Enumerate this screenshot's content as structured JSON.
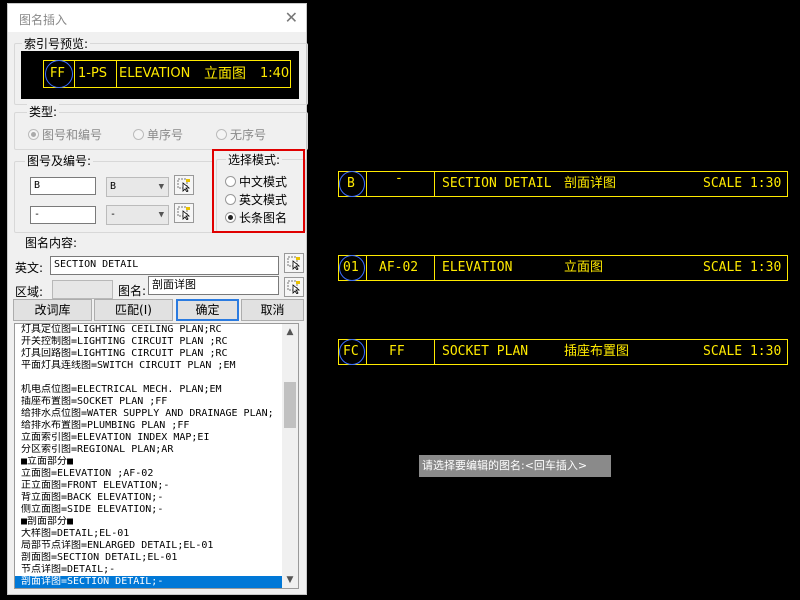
{
  "dialog": {
    "title": "图名插入",
    "close_glyph": "✕",
    "preview": {
      "label": "索引号预览:",
      "circle_text": "FF",
      "sheet": "1-PS",
      "name_en": "ELEVATION",
      "name_cn": "立面图",
      "scale": "1:40"
    },
    "type_group": {
      "label": "类型:",
      "options": [
        "图号和编号",
        "单序号",
        "无序号"
      ]
    },
    "number_group": {
      "label": "图号及编号:",
      "input1": "B",
      "combo1": "B",
      "input2": "-",
      "combo2": "-"
    },
    "mode_group": {
      "label": "选择模式:",
      "options": [
        "中文模式",
        "英文模式",
        "长条图名"
      ]
    },
    "content_label": "图名内容:",
    "english_label": "英文:",
    "english_value": "SECTION DETAIL",
    "area_label": "区域:",
    "area_value": "",
    "name_label": "图名:",
    "name_value": "剖面详图",
    "buttons": {
      "edit_lib": "改词库",
      "match": "匹配(I)",
      "ok": "确定",
      "cancel": "取消"
    },
    "list_items": [
      "灯具定位图=LIGHTING CEILING PLAN;RC",
      "开关控制图=LIGHTING CIRCUIT PLAN  ;RC",
      "灯具回路图=LIGHTING CIRCUIT PLAN  ;RC",
      "平面灯具连线图=SWITCH CIRCUIT PLAN  ;EM",
      "",
      "机电点位图=ELECTRICAL MECH. PLAN;EM",
      "插座布置图=SOCKET PLAN  ;FF",
      "给排水点位图=WATER SUPPLY AND DRAINAGE PLAN;",
      "给排水布置图=PLUMBING PLAN  ;FF",
      "立面索引图=ELEVATION INDEX MAP;EI",
      "分区索引图=REGIONAL PLAN;AR",
      "■立面部分■",
      "立面图=ELEVATION ;AF-02",
      "正立面图=FRONT ELEVATION;-",
      "背立面图=BACK ELEVATION;-",
      "侧立面图=SIDE ELEVATION;-",
      "■剖面部分■",
      "大样图=DETAIL;EL-01",
      "局部节点详图=ENLARGED DETAIL;EL-01",
      "剖面图=SECTION DETAIL;EL-01",
      "节点详图=DETAIL;-",
      "剖面详图=SECTION DETAIL;-"
    ],
    "selected_index": 21
  },
  "canvas": {
    "rows": [
      {
        "circle": "B",
        "number": "-",
        "name_en": "SECTION DETAIL",
        "name_cn": "剖面详图",
        "scale": "SCALE 1:30"
      },
      {
        "circle": "01",
        "number": "AF-02",
        "name_en": "ELEVATION",
        "name_cn": "立面图",
        "scale": "SCALE 1:30"
      },
      {
        "circle": "FC",
        "number": "FF",
        "name_en": "SOCKET PLAN",
        "name_cn": "插座布置图",
        "scale": "SCALE 1:30"
      }
    ],
    "prompt": "请选择要编辑的图名:<回车插入>"
  },
  "colors": {
    "cad_line": "#ffea00",
    "cad_circle": "#3b6dff",
    "highlight": "#e00000",
    "selection": "#0078d7"
  }
}
